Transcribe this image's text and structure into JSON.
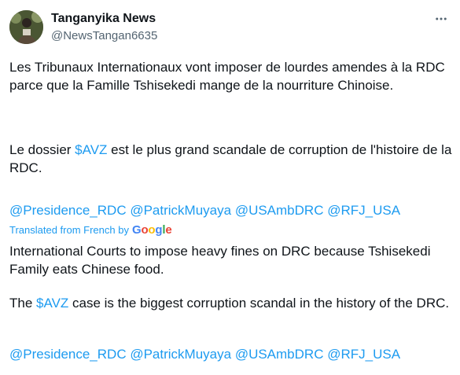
{
  "author": {
    "name": "Tanganyika News",
    "handle": "@NewsTangan6635"
  },
  "original": {
    "para1": "Les Tribunaux Internationaux vont imposer de lourdes amendes à la RDC parce que la Famille Tshisekedi mange de la nourriture Chinoise.",
    "para2_before": "Le dossier ",
    "para2_cashtag": "$AVZ",
    "para2_after": " est le plus grand scandale de corruption de l'histoire de la RDC.",
    "mentions": [
      "@Presidence_RDC",
      "@PatrickMuyaya",
      "@USAmbDRC",
      "@RFJ_USA"
    ]
  },
  "translation": {
    "label": "Translated from French by",
    "provider": "Google",
    "para1": "International Courts to impose heavy fines on DRC because Tshisekedi Family eats Chinese food.",
    "para2_before": "The ",
    "para2_cashtag": "$AVZ",
    "para2_after": " case is the biggest corruption scandal in the history of the DRC.",
    "mentions": [
      "@Presidence_RDC",
      "@PatrickMuyaya",
      "@USAmbDRC",
      "@RFJ_USA"
    ]
  },
  "icons": {
    "more": "more-horizontal-icon",
    "avatar": "profile-photo"
  },
  "colors": {
    "link": "#1d9bf0",
    "text": "#0f1419",
    "secondary": "#536471"
  }
}
